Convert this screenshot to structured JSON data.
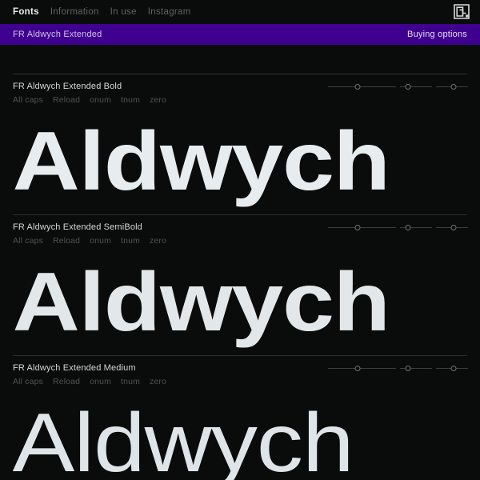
{
  "nav": {
    "items": [
      {
        "label": "Fonts",
        "active": true
      },
      {
        "label": "Information",
        "active": false
      },
      {
        "label": "In use",
        "active": false
      },
      {
        "label": "Instagram",
        "active": false
      }
    ],
    "logo_icon": "foundry-logo-mark"
  },
  "titlebar": {
    "family_name": "FR Aldwych Extended",
    "buying_label": "Buying options",
    "accent_color": "#3f0090"
  },
  "theme": {
    "background": "#0a0c0b",
    "text_primary": "#e7ecee",
    "text_muted": "#5e6261",
    "rule_color": "#2b2f2e"
  },
  "sample_word": "Aldwych",
  "feature_labels": [
    "All caps",
    "Reload",
    "onum",
    "tnum",
    "zero"
  ],
  "sliders": [
    {
      "name": "size-slider",
      "value_pct": 44
    },
    {
      "name": "leading-slider",
      "value_pct": 25
    },
    {
      "name": "tracking-slider",
      "value_pct": 55
    }
  ],
  "specimens": [
    {
      "style_name": "FR Aldwych Extended Bold",
      "weight": "bold",
      "word": "Aldwych"
    },
    {
      "style_name": "FR Aldwych Extended SemiBold",
      "weight": "semibold",
      "word": "Aldwych"
    },
    {
      "style_name": "FR Aldwych Extended Medium",
      "weight": "medium",
      "word": "Aldwych"
    }
  ]
}
